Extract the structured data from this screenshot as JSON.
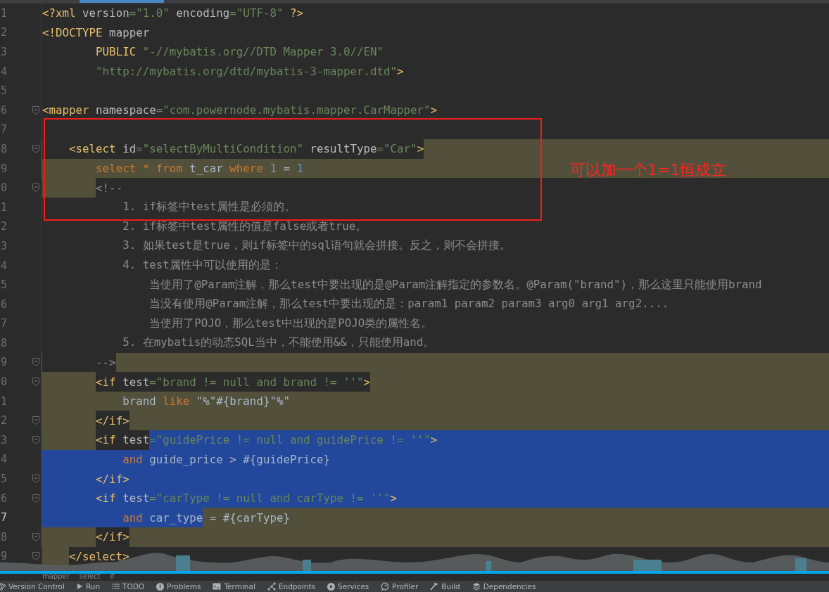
{
  "editor": {
    "lines": [
      {
        "number": "1",
        "fold": false,
        "current": false,
        "highlighted": false,
        "selected": false,
        "tokens": [
          {
            "kind": "tag",
            "text": "<?xml",
            "highlighted": false,
            "selected": false
          },
          {
            "kind": "attr",
            "text": " version",
            "highlighted": false,
            "selected": false
          },
          {
            "kind": "str",
            "text": "=\"1.0\"",
            "highlighted": false,
            "selected": false
          },
          {
            "kind": "attr",
            "text": " encoding",
            "highlighted": false,
            "selected": false
          },
          {
            "kind": "str",
            "text": "=\"UTF-8\"",
            "highlighted": false,
            "selected": false
          },
          {
            "kind": "tag",
            "text": " ?>",
            "highlighted": false,
            "selected": false
          }
        ]
      },
      {
        "number": "2",
        "fold": false,
        "current": false,
        "highlighted": false,
        "selected": false,
        "tokens": [
          {
            "kind": "tag",
            "text": "<!DOCTYPE",
            "highlighted": false,
            "selected": false
          },
          {
            "kind": "attr",
            "text": " mapper",
            "highlighted": false,
            "selected": false
          }
        ]
      },
      {
        "number": "3",
        "fold": false,
        "current": false,
        "highlighted": false,
        "selected": false,
        "indent_highlighted": false,
        "indent_selected": false,
        "tokens": [
          {
            "kind": "tag",
            "text": "        PUBLIC",
            "highlighted": false,
            "selected": false
          },
          {
            "kind": "str",
            "text": " \"-//mybatis.org//DTD Mapper 3.0//EN\"",
            "highlighted": false,
            "selected": false
          }
        ]
      },
      {
        "number": "4",
        "fold": false,
        "current": false,
        "highlighted": false,
        "selected": false,
        "indent_highlighted": false,
        "indent_selected": false,
        "tokens": [
          {
            "kind": "str",
            "text": "        \"http://mybatis.org/dtd/mybatis-3-mapper.dtd\"",
            "highlighted": false,
            "selected": false
          },
          {
            "kind": "tag",
            "text": ">",
            "highlighted": false,
            "selected": false
          }
        ]
      },
      {
        "number": "5",
        "fold": false,
        "current": false,
        "highlighted": false,
        "selected": false
      },
      {
        "number": "6",
        "fold": true,
        "current": false,
        "highlighted": false,
        "selected": false,
        "tokens": [
          {
            "kind": "tag",
            "text": "<mapper",
            "highlighted": false,
            "selected": false
          },
          {
            "kind": "attr",
            "text": " namespace",
            "highlighted": false,
            "selected": false
          },
          {
            "kind": "str",
            "text": "=\"com.powernode.mybatis.mapper.CarMapper\"",
            "highlighted": false,
            "selected": false
          },
          {
            "kind": "tag",
            "text": ">",
            "highlighted": false,
            "selected": false
          }
        ]
      },
      {
        "number": "7",
        "fold": false,
        "current": false,
        "highlighted": false,
        "selected": false
      },
      {
        "number": "8",
        "fold": true,
        "current": false,
        "highlighted": true,
        "selected": false,
        "indent_highlighted": false,
        "indent_selected": false,
        "tokens": [
          {
            "kind": "tag",
            "text": "    <select",
            "highlighted": false,
            "selected": false
          },
          {
            "kind": "attr",
            "text": " id",
            "highlighted": false,
            "selected": false
          },
          {
            "kind": "str",
            "text": "=\"selectByMultiCondition\"",
            "highlighted": false,
            "selected": false
          },
          {
            "kind": "attr",
            "text": " resultType",
            "highlighted": false,
            "selected": false
          },
          {
            "kind": "str",
            "text": "=\"Car\"",
            "highlighted": false,
            "selected": false
          },
          {
            "kind": "tag",
            "text": ">",
            "highlighted": false,
            "selected": false
          }
        ]
      },
      {
        "number": "9",
        "fold": false,
        "current": false,
        "highlighted": true,
        "selected": false,
        "indent_highlighted": true,
        "indent_selected": false,
        "tokens": [
          {
            "kind": "kw",
            "text": "        select * from",
            "highlighted": true,
            "selected": false
          },
          {
            "kind": "plain",
            "text": " t_car ",
            "highlighted": true,
            "selected": false
          },
          {
            "kind": "kw",
            "text": "where",
            "highlighted": true,
            "selected": false
          },
          {
            "kind": "num",
            "text": " 1",
            "highlighted": true,
            "selected": false
          },
          {
            "kind": "plain",
            "text": " = ",
            "highlighted": true,
            "selected": false
          },
          {
            "kind": "num",
            "text": "1",
            "highlighted": true,
            "selected": false
          }
        ]
      },
      {
        "number": "0",
        "fold": true,
        "current": false,
        "highlighted": false,
        "selected": false,
        "indent_highlighted": true,
        "indent_selected": false,
        "tokens": [
          {
            "kind": "comment",
            "text": "        <!--",
            "highlighted": false,
            "selected": false
          }
        ]
      },
      {
        "number": "1",
        "fold": false,
        "current": false,
        "highlighted": false,
        "selected": false,
        "indent_highlighted": false,
        "indent_selected": false,
        "tokens": [
          {
            "kind": "comment",
            "text": "            1. if标签中test属性是必须的。",
            "highlighted": false,
            "selected": false
          }
        ]
      },
      {
        "number": "2",
        "fold": false,
        "current": false,
        "highlighted": false,
        "selected": false,
        "indent_highlighted": false,
        "indent_selected": false,
        "tokens": [
          {
            "kind": "comment",
            "text": "            2. if标签中test属性的值是false或者true。",
            "highlighted": false,
            "selected": false
          }
        ]
      },
      {
        "number": "3",
        "fold": false,
        "current": false,
        "highlighted": false,
        "selected": false,
        "indent_highlighted": false,
        "indent_selected": false,
        "tokens": [
          {
            "kind": "comment",
            "text": "            3. 如果test是true，则if标签中的sql语句就会拼接。反之，则不会拼接。",
            "highlighted": false,
            "selected": false
          }
        ]
      },
      {
        "number": "4",
        "fold": false,
        "current": false,
        "highlighted": false,
        "selected": false,
        "indent_highlighted": false,
        "indent_selected": false,
        "tokens": [
          {
            "kind": "comment",
            "text": "            4. test属性中可以使用的是：",
            "highlighted": false,
            "selected": false
          }
        ]
      },
      {
        "number": "5",
        "fold": false,
        "current": false,
        "highlighted": false,
        "selected": false,
        "indent_highlighted": false,
        "indent_selected": false,
        "tokens": [
          {
            "kind": "comment",
            "text": "                当使用了@Param注解，那么test中要出现的是@Param注解指定的参数名。@Param(\"brand\")，那么这里只能使用brand",
            "highlighted": false,
            "selected": false
          }
        ]
      },
      {
        "number": "6",
        "fold": false,
        "current": false,
        "highlighted": false,
        "selected": false,
        "indent_highlighted": false,
        "indent_selected": false,
        "tokens": [
          {
            "kind": "comment",
            "text": "                当没有使用@Param注解，那么test中要出现的是：param1 param2 param3 arg0 arg1 arg2....",
            "highlighted": false,
            "selected": false
          }
        ]
      },
      {
        "number": "7",
        "fold": false,
        "current": false,
        "highlighted": false,
        "selected": false,
        "indent_highlighted": false,
        "indent_selected": false,
        "tokens": [
          {
            "kind": "comment",
            "text": "                当使用了POJO，那么test中出现的是POJO类的属性名。",
            "highlighted": false,
            "selected": false
          }
        ]
      },
      {
        "number": "8",
        "fold": false,
        "current": false,
        "highlighted": false,
        "selected": false,
        "indent_highlighted": false,
        "indent_selected": false,
        "tokens": [
          {
            "kind": "comment",
            "text": "            5. 在mybatis的动态SQL当中，不能使用&&，只能使用and。",
            "highlighted": false,
            "selected": false
          }
        ]
      },
      {
        "number": "9",
        "fold": true,
        "current": false,
        "highlighted": true,
        "selected": false,
        "indent_highlighted": false,
        "indent_selected": false,
        "tokens": [
          {
            "kind": "comment",
            "text": "        -->",
            "highlighted": false,
            "selected": false
          }
        ]
      },
      {
        "number": "0",
        "fold": true,
        "current": false,
        "highlighted": true,
        "selected": false,
        "indent_highlighted": true,
        "indent_selected": false,
        "tokens": [
          {
            "kind": "tag",
            "text": "        <if",
            "highlighted": false,
            "selected": false
          },
          {
            "kind": "attr",
            "text": " test",
            "highlighted": false,
            "selected": false
          },
          {
            "kind": "str",
            "text": "=\"brand != null and brand != ''\"",
            "highlighted": false,
            "selected": false
          },
          {
            "kind": "tag",
            "text": ">",
            "highlighted": false,
            "selected": false
          }
        ]
      },
      {
        "number": "1",
        "fold": false,
        "current": false,
        "highlighted": true,
        "selected": false,
        "indent_highlighted": true,
        "indent_selected": false,
        "tokens": [
          {
            "kind": "plain",
            "text": "            brand",
            "highlighted": true,
            "selected": false
          },
          {
            "kind": "kw",
            "text": " like ",
            "highlighted": true,
            "selected": false
          },
          {
            "kind": "plain",
            "text": "\"%\"#{brand}\"%\"",
            "highlighted": true,
            "selected": false
          }
        ]
      },
      {
        "number": "2",
        "fold": true,
        "current": false,
        "highlighted": true,
        "selected": false,
        "indent_highlighted": true,
        "indent_selected": false,
        "tokens": [
          {
            "kind": "tag",
            "text": "        </if>",
            "highlighted": false,
            "selected": false
          }
        ]
      },
      {
        "number": "3",
        "fold": true,
        "current": false,
        "selected": true,
        "indent_highlighted": true,
        "indent_selected": false,
        "tokens": [
          {
            "kind": "tag",
            "text": "        <if",
            "highlighted": false,
            "selected": false
          },
          {
            "kind": "attr",
            "text": " test",
            "highlighted": false,
            "selected": false
          },
          {
            "kind": "str",
            "text": "=\"guidePrice != null and guidePrice != ''\"",
            "selected": true
          },
          {
            "kind": "tag",
            "text": ">",
            "selected": true
          }
        ]
      },
      {
        "number": "4",
        "fold": false,
        "current": false,
        "selected": true,
        "indent_selected": true,
        "tokens": [
          {
            "kind": "kw",
            "text": "            and",
            "selected": true
          },
          {
            "kind": "plain",
            "text": " guide_price > #{guidePrice}",
            "selected": true
          }
        ]
      },
      {
        "number": "5",
        "fold": true,
        "current": false,
        "selected": true,
        "indent_selected": true,
        "tokens": [
          {
            "kind": "tag",
            "text": "        </if>",
            "selected": true
          }
        ]
      },
      {
        "number": "6",
        "fold": true,
        "current": false,
        "selected": true,
        "indent_selected": true,
        "tokens": [
          {
            "kind": "tag",
            "text": "        <if",
            "selected": true
          },
          {
            "kind": "attr",
            "text": " test",
            "selected": true
          },
          {
            "kind": "str",
            "text": "=\"carType != null and carType != ''\"",
            "selected": true
          },
          {
            "kind": "tag",
            "text": ">",
            "selected": true
          }
        ]
      },
      {
        "number": "7",
        "fold": false,
        "current": true,
        "highlighted": true,
        "selected": false,
        "indent_selected": true,
        "tokens": [
          {
            "kind": "kw",
            "text": "            and",
            "selected": true
          },
          {
            "kind": "plain",
            "text": " car_type",
            "selected": true
          },
          {
            "kind": "plain",
            "text": " = #{carType}",
            "highlighted": true,
            "selected": false
          }
        ]
      },
      {
        "number": "8",
        "fold": true,
        "current": false,
        "highlighted": true,
        "selected": false,
        "indent_highlighted": true,
        "indent_selected": false,
        "tokens": [
          {
            "kind": "tag",
            "text": "        </if>",
            "highlighted": false,
            "selected": false
          }
        ]
      },
      {
        "number": "9",
        "fold": true,
        "current": false,
        "highlighted": false,
        "selected": false,
        "indent_highlighted": true,
        "indent_selected": false,
        "tokens": [
          {
            "kind": "tag",
            "text": "    </select>",
            "highlighted": false,
            "selected": false
          }
        ]
      }
    ]
  },
  "annotation": {
    "text": "可以加一个1=1恒成立"
  },
  "breadcrumb": [
    "mapper",
    "select",
    "if"
  ],
  "tool_bar": [
    {
      "kind": "vcs",
      "label": "Version Control"
    },
    {
      "kind": "run",
      "label": "Run"
    },
    {
      "kind": "todo",
      "label": "TODO"
    },
    {
      "kind": "problems",
      "label": "Problems"
    },
    {
      "kind": "terminal",
      "label": "Terminal"
    },
    {
      "kind": "endpoints",
      "label": "Endpoints"
    },
    {
      "kind": "services",
      "label": "Services"
    },
    {
      "kind": "profiler",
      "label": "Profiler"
    },
    {
      "kind": "build",
      "label": "Build"
    },
    {
      "kind": "dependencies",
      "label": "Dependencies"
    }
  ]
}
